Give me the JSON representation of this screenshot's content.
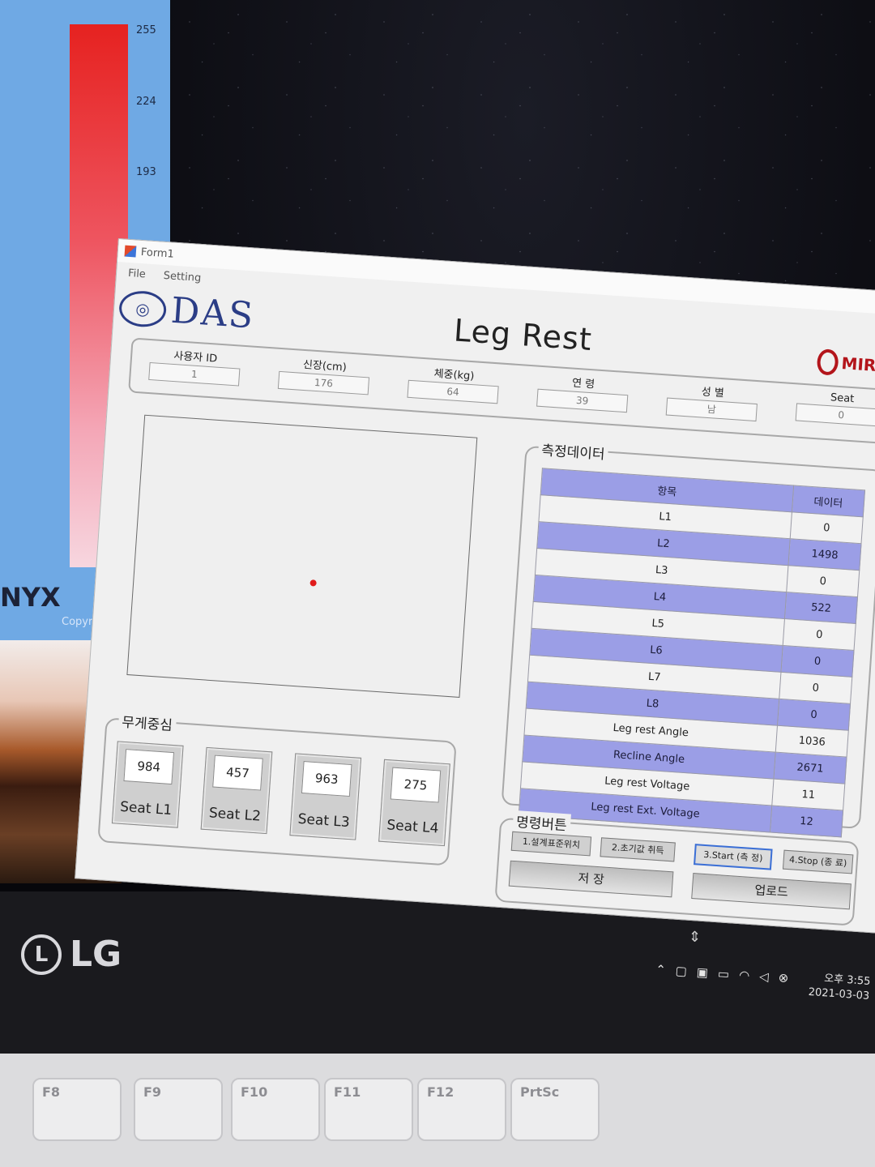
{
  "background": {
    "heat_ticks": [
      "255",
      "224",
      "193"
    ],
    "side_label": "NYX",
    "copyright": "Copyright",
    "brand": "LG",
    "keys": [
      "F8",
      "F9",
      "F10",
      "F11",
      "F12",
      "PrtSc"
    ]
  },
  "window": {
    "title": "Form1",
    "menu": [
      "File",
      "Setting"
    ],
    "logo_text": "DAS",
    "page_title": "Leg Rest",
    "partner_logo": "MIR"
  },
  "user_info": {
    "fields": [
      {
        "label": "사용자 ID",
        "value": "1"
      },
      {
        "label": "신장(cm)",
        "value": "176"
      },
      {
        "label": "체중(kg)",
        "value": "64"
      },
      {
        "label": "연 령",
        "value": "39"
      },
      {
        "label": "성 별",
        "value": "남"
      },
      {
        "label": "Seat",
        "value": "0"
      }
    ]
  },
  "plot": {
    "dot_x": 0.54,
    "dot_y": 0.6,
    "dot_color": "#e01b1b"
  },
  "weight_center": {
    "title": "무게중심",
    "seats": [
      {
        "name": "Seat L1",
        "value": "984"
      },
      {
        "name": "Seat L2",
        "value": "457"
      },
      {
        "name": "Seat L3",
        "value": "963"
      },
      {
        "name": "Seat L4",
        "value": "275"
      }
    ]
  },
  "measurement": {
    "title": "측정데이터",
    "header": {
      "item": "항목",
      "data": "데이터"
    },
    "rows": [
      {
        "item": "L1",
        "data": "0"
      },
      {
        "item": "L2",
        "data": "1498"
      },
      {
        "item": "L3",
        "data": "0"
      },
      {
        "item": "L4",
        "data": "522"
      },
      {
        "item": "L5",
        "data": "0"
      },
      {
        "item": "L6",
        "data": "0"
      },
      {
        "item": "L7",
        "data": "0"
      },
      {
        "item": "L8",
        "data": "0"
      },
      {
        "item": "Leg rest Angle",
        "data": "1036"
      },
      {
        "item": "Recline Angle",
        "data": "2671"
      },
      {
        "item": "Leg rest Voltage",
        "data": "11"
      },
      {
        "item": "Leg rest Ext. Voltage",
        "data": "12"
      }
    ]
  },
  "commands": {
    "title": "명령버튼",
    "buttons": [
      "1.설계표준위치",
      "2.초기값 취득",
      "3.Start (측 정)",
      "4.Stop (종 료)"
    ],
    "save": "저 장",
    "upload": "업로드"
  },
  "taskbar": {
    "time": "오후 3:55",
    "date": "2021-03-03"
  },
  "colors": {
    "accent_purple": "#9b9ee6",
    "brand_blue": "#2b3d86",
    "brand_red": "#b3151b"
  }
}
